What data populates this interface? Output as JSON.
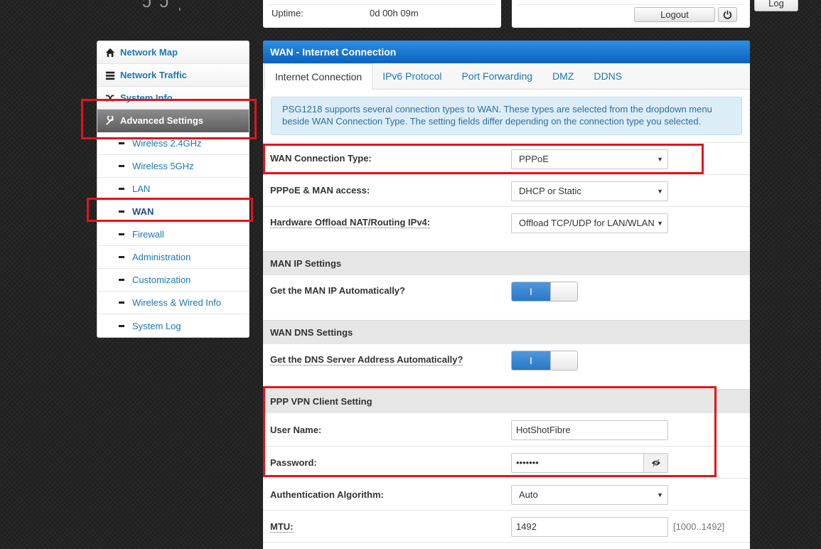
{
  "header": {
    "uptime_label": "Uptime:",
    "uptime_value": "0d 00h 09m",
    "logout_label": "Logout",
    "log_label": "Log"
  },
  "sidebar": {
    "menu": [
      {
        "label": "Network Map",
        "icon": "home-icon"
      },
      {
        "label": "Network Traffic",
        "icon": "list-icon"
      },
      {
        "label": "System Info",
        "icon": "shuffle-icon"
      },
      {
        "label": "Advanced Settings",
        "icon": "wrench-icon"
      }
    ],
    "submenu": [
      {
        "label": "Wireless 2.4GHz"
      },
      {
        "label": "Wireless 5GHz"
      },
      {
        "label": "LAN"
      },
      {
        "label": "WAN"
      },
      {
        "label": "Firewall"
      },
      {
        "label": "Administration"
      },
      {
        "label": "Customization"
      },
      {
        "label": "Wireless & Wired Info"
      },
      {
        "label": "System Log"
      }
    ]
  },
  "panel": {
    "title": "WAN - Internet Connection",
    "tabs": [
      "Internet Connection",
      "IPv6 Protocol",
      "Port Forwarding",
      "DMZ",
      "DDNS"
    ],
    "info": "PSG1218 supports several connection types to WAN. These types are selected from the dropdown menu beside WAN Connection Type. The setting fields differ depending on the connection type you selected.",
    "wan_type_label": "WAN Connection Type:",
    "wan_type_value": "PPPoE",
    "man_access_label": "PPPoE & MAN access:",
    "man_access_value": "DHCP or Static",
    "hw_offload_label": "Hardware Offload NAT/Routing IPv4:",
    "hw_offload_value": "Offload TCP/UDP for LAN/WLAN",
    "man_ip_section": "MAN IP Settings",
    "man_ip_auto_label": "Get the MAN IP Automatically?",
    "wan_dns_section": "WAN DNS Settings",
    "dns_auto_label": "Get the DNS Server Address Automatically?",
    "ppp_section": "PPP VPN Client Setting",
    "username_label": "User Name:",
    "username_value": "HotShotFibre",
    "password_label": "Password:",
    "password_value": "•••••••",
    "auth_label": "Authentication Algorithm:",
    "auth_value": "Auto",
    "mtu_label": "MTU:",
    "mtu_value": "1492",
    "mtu_hint": "[1000..1492]",
    "toggle_on_text": "I"
  }
}
